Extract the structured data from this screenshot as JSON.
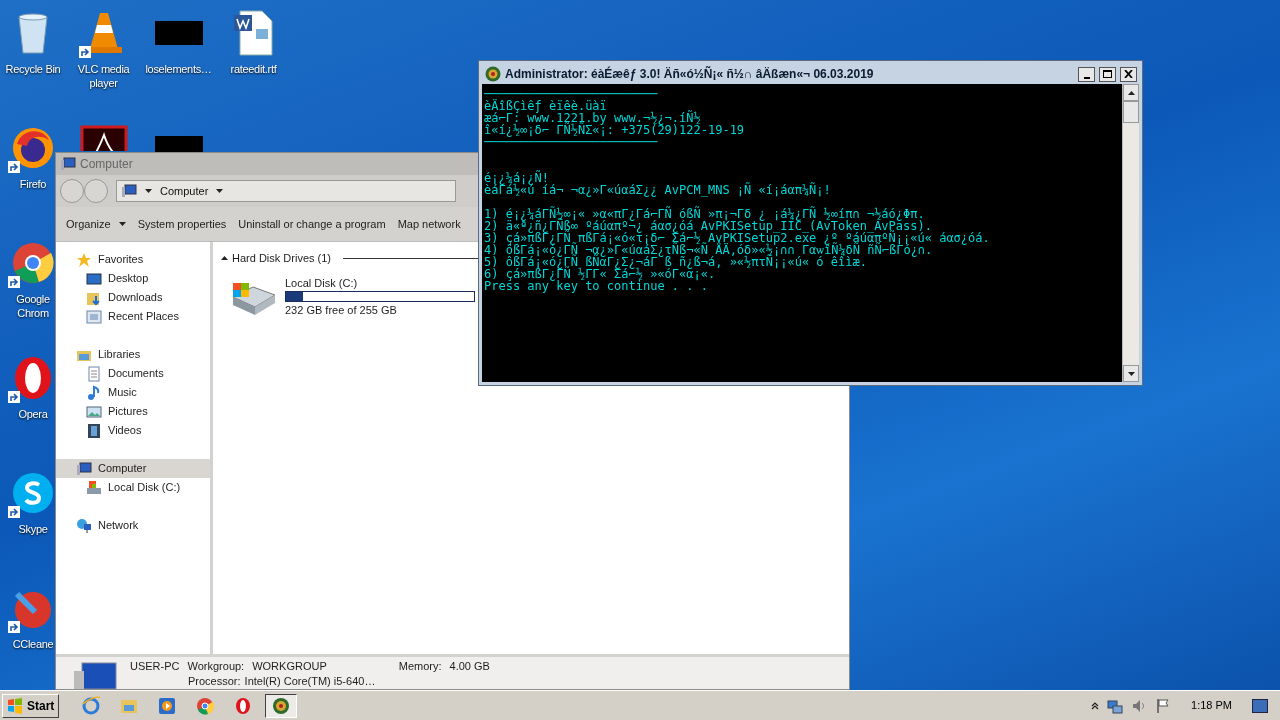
{
  "desktop": {
    "columns": [
      [
        {
          "kind": "recycle",
          "label": "Recycle Bin"
        },
        {
          "kind": "firefox",
          "label": "Firefo"
        },
        {
          "kind": "chrome",
          "label": "Google Chrom"
        },
        {
          "kind": "opera",
          "label": "Opera"
        },
        {
          "kind": "skype",
          "label": "Skype"
        },
        {
          "kind": "ccleaner",
          "label": "CCleane"
        }
      ],
      [
        {
          "kind": "vlc",
          "label": "VLC media player"
        },
        {
          "kind": "acrobat"
        }
      ],
      [
        {
          "kind": "blackfile",
          "label": "loselements…"
        },
        {
          "kind": "blackfile"
        }
      ],
      [
        {
          "kind": "word",
          "label": "rateedit.rtf"
        }
      ]
    ]
  },
  "explorer": {
    "title": "Computer",
    "breadcrumb": "Computer",
    "toolbar": [
      "Organize",
      "System properties",
      "Uninstall or change a program",
      "Map network"
    ],
    "nav": [
      {
        "kind": "star",
        "label": "Favorites",
        "selected": false,
        "children": [
          {
            "kind": "desktop",
            "label": "Desktop",
            "selected": false
          },
          {
            "kind": "downloads",
            "label": "Downloads",
            "selected": false
          },
          {
            "kind": "recent",
            "label": "Recent Places",
            "selected": false
          }
        ]
      },
      {
        "kind": "library",
        "label": "Libraries",
        "selected": false,
        "children": [
          {
            "kind": "documents",
            "label": "Documents",
            "selected": false
          },
          {
            "kind": "music",
            "label": "Music",
            "selected": false
          },
          {
            "kind": "pictures",
            "label": "Pictures",
            "selected": false
          },
          {
            "kind": "videos",
            "label": "Videos",
            "selected": false
          }
        ]
      },
      {
        "kind": "computer",
        "label": "Computer",
        "selected": true,
        "children": [
          {
            "kind": "disk",
            "label": "Local Disk (C:)",
            "selected": false
          }
        ]
      },
      {
        "kind": "network",
        "label": "Network",
        "selected": false
      }
    ],
    "group": {
      "title": "Hard Disk Drives (1)",
      "drives": [
        {
          "name": "Local Disk (C:)",
          "level": 0.09,
          "free": "232 GB free of 255 GB"
        }
      ]
    },
    "details": {
      "name": "USER-PC",
      "workgroup_label": "Workgroup:",
      "workgroup": "WORKGROUP",
      "memory_label": "Memory:",
      "memory": "4.00 GB",
      "processor_label": "Processor:",
      "processor": "Intel(R) Core(TM) i5-640…"
    }
  },
  "console": {
    "title": "Administrator: éàÉæêƒ 3.0! Äñ«ó½Ñ¡« ñ½∩ âÄßæn«¬ 06.03.2019",
    "blocks": [
      [
        "────────────────────────",
        "èÄîßÇìêƒ èïêè.üàï",
        "æá⌐Γ: www.1221.by www.¬½¿¬.íÑ½",
        "î«í¿½∞¡δ⌐ ΓÑ½ÑΣ«¡: +375(29)122-19-19",
        "────────────────────────"
      ],
      [
        "é¡¿¼á¡¿Ñ!",
        "èáΓá½«ú íá¬ ¬α¿»Γ«úαáΣ¿¿ AvPCM_MNS ¡Ñ «í¡áαπ¼Ñ¡!"
      ],
      [
        "1) é¡¿¼áΓÑ½∞¡« »α«πΓ¿Γá⌐ΓÑ óßÑ »π¡¬Γδ ¿ ¡á¼¿ΓÑ ½∞íπ∩ ¬½áó¿Φπ.",
        "2) ä«ª¿ñ¿ΓÑß∞ ºáúαπº¬¿ áασ¿óá AvPKISetup_IIC_(AvToken_AvPass).",
        "3) çá»πßΓ¿ΓÑ πßΓá¡«ó«τ¡δ⌐ Σá⌐½ AvPKISetup2.exe ¿º ºáúαπºÑ¡¡«ú« áασ¿óá.",
        "4) ôßΓá¡«ó¿ΓÑ ¬α¿»Γ«úαáΣ¿τÑß¬«Ñ ÅÄ,óδ»«½¡∩∩ ΓαѡîÑ¼δÑ ñÑ⌐ßΓó¿∩.",
        "5) ôßΓá¡«ó¿ΓÑ ßÑαΓ¿Σ¿¬áΓ ß ñ¿ß¬á, »«½πτÑ¡¡«ú« ó êîìæ.",
        "6) çá»πßΓ¿ΓÑ ½ΓΓ« Σá⌐½ »«óΓ«α¡«.",
        "Press any key to continue . . ."
      ]
    ]
  },
  "taskbar": {
    "start": "Start",
    "items": [
      {
        "kind": "ie",
        "selected": false
      },
      {
        "kind": "explorer",
        "selected": false
      },
      {
        "kind": "media",
        "selected": false
      },
      {
        "kind": "chrome",
        "selected": false
      },
      {
        "kind": "opera",
        "selected": false
      },
      {
        "kind": "console",
        "selected": true
      }
    ],
    "time": "1:18 PM"
  }
}
